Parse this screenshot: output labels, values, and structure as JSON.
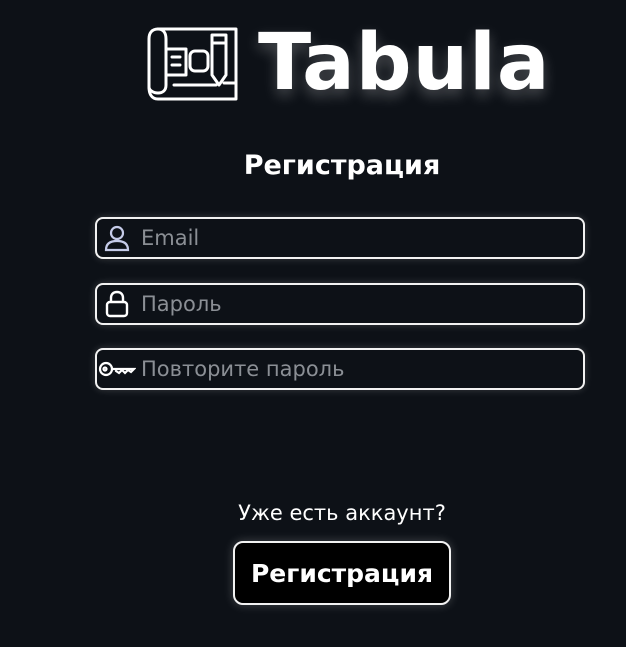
{
  "brand": {
    "name": "Tabula",
    "icon": "blueprint-pencil-icon"
  },
  "form": {
    "title": "Регистрация",
    "fields": [
      {
        "name": "email",
        "placeholder": "Email",
        "value": "",
        "icon": "user-icon"
      },
      {
        "name": "password",
        "placeholder": "Пароль",
        "value": "",
        "icon": "lock-icon"
      },
      {
        "name": "password_repeat",
        "placeholder": "Повторите пароль",
        "value": "",
        "icon": "key-icon"
      }
    ],
    "login_link": "Уже есть аккаунт?",
    "submit_label": "Регистрация"
  },
  "colors": {
    "background": "#0d1117",
    "text": "#ffffff",
    "placeholder": "#8b8f95",
    "field_border": "#f2f2f2",
    "icon_accent": "#c5cbe8",
    "button_bg": "#000000"
  }
}
